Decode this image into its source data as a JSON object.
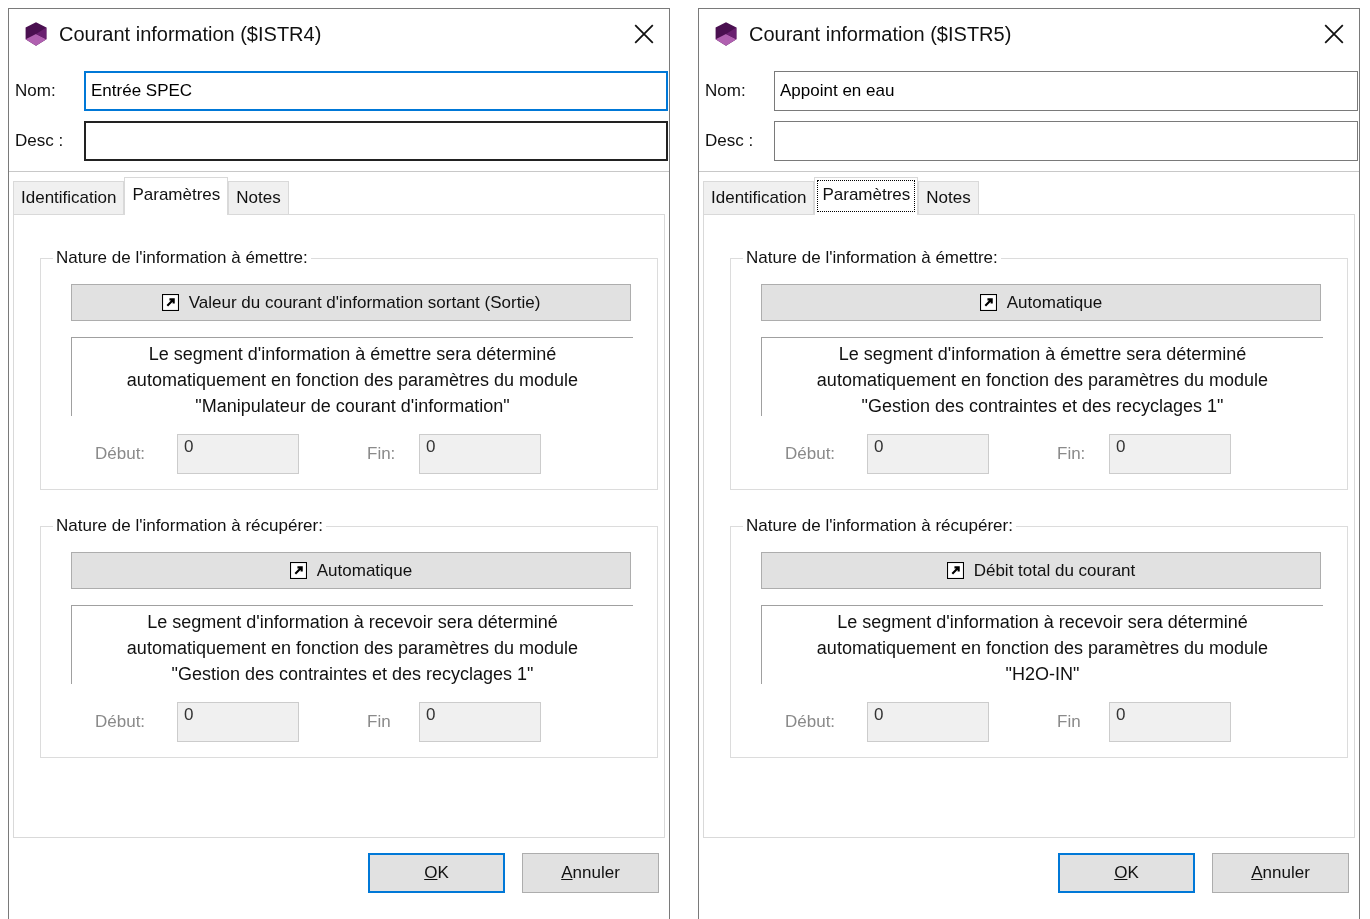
{
  "dialogs": [
    {
      "title": "Courant information ($ISTR4)",
      "fields": [
        {
          "label": "Nom:",
          "value": "Entrée SPEC",
          "focused": true
        },
        {
          "label": "Desc :",
          "focused": false
        }
      ],
      "tabs": [
        {
          "label": "Identification",
          "selected": false,
          "focused": false
        },
        {
          "label": "Paramètres",
          "selected": true,
          "focused": false
        },
        {
          "label": "Notes",
          "selected": false,
          "focused": false
        }
      ],
      "groups": [
        {
          "legend": "Nature de l'information à émettre:",
          "button": "Valeur du courant d'information sortant (Sortie)",
          "description": "Le segment d'information à émettre sera déterminé automatiquement en fonction des paramètres du module \"Manipulateur de courant d'information\"",
          "fields": [
            {
              "label": "Début:",
              "value": "0",
              "disabled": true
            },
            {
              "label": "Fin:",
              "value": "0",
              "disabled": true
            }
          ]
        },
        {
          "legend": "Nature de l'information à récupérer:",
          "button": "Automatique",
          "description": "Le segment d'information à recevoir sera déterminé automatiquement en fonction des paramètres du module \"Gestion des contraintes et des recyclages 1\"",
          "fields": [
            {
              "label": "Début:",
              "value": "0",
              "disabled": true
            },
            {
              "label": "Fin",
              "value": "0",
              "disabled": true
            }
          ]
        }
      ],
      "buttons": [
        {
          "label": "OK",
          "default": true
        },
        {
          "label": "Annuler",
          "default": false
        }
      ]
    },
    {
      "title": "Courant information ($ISTR5)",
      "fields": [
        {
          "label": "Nom:",
          "value": "Appoint en eau",
          "focused": false
        },
        {
          "label": "Desc :",
          "focused": false
        }
      ],
      "tabs": [
        {
          "label": "Identification",
          "selected": false,
          "focused": false
        },
        {
          "label": "Paramètres",
          "selected": true,
          "focused": true
        },
        {
          "label": "Notes",
          "selected": false,
          "focused": false
        }
      ],
      "groups": [
        {
          "legend": "Nature de l'information à émettre:",
          "button": "Automatique",
          "description": "Le segment d'information à émettre sera déterminé automatiquement en fonction des paramètres du module \"Gestion des contraintes et des recyclages 1\"",
          "fields": [
            {
              "label": "Début:",
              "value": "0",
              "disabled": true
            },
            {
              "label": "Fin:",
              "value": "0",
              "disabled": true
            }
          ]
        },
        {
          "legend": "Nature de l'information à récupérer:",
          "button": "Débit total du courant",
          "description": "Le segment d'information à recevoir sera déterminé automatiquement en fonction des paramètres du module \"H2O-IN\"",
          "fields": [
            {
              "label": "Début:",
              "value": "0",
              "disabled": true
            },
            {
              "label": "Fin",
              "value": "0",
              "disabled": true
            }
          ]
        }
      ],
      "buttons": [
        {
          "label": "OK",
          "default": true
        },
        {
          "label": "Annuler",
          "default": false
        }
      ]
    }
  ]
}
